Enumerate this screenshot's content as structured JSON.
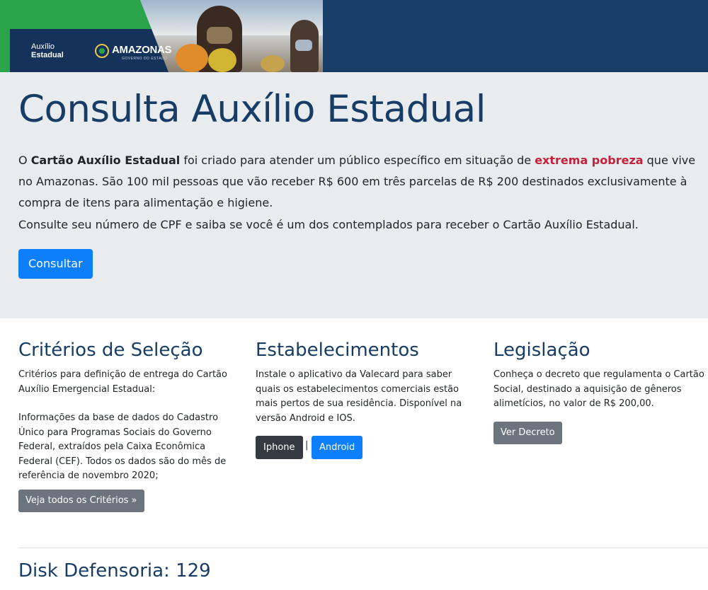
{
  "banner": {
    "brand_line1": "Auxílio",
    "brand_line2": "Estadual",
    "amazonas": "AMAZONAS",
    "amazonas_sub": "GOVERNO DO ESTADO"
  },
  "jumbotron": {
    "title": "Consulta Auxílio Estadual",
    "lead_p1_part1": "O ",
    "lead_p1_bold": "Cartão Auxílio Estadual",
    "lead_p1_part2": " foi criado para atender um público específico em situação de ",
    "lead_p1_highlight": "extrema pobreza",
    "lead_p1_part3": " que vive no Amazonas. São 100 mil pessoas que vão receber R$ 600 em três parcelas de R$ 200 destinados exclusivamente à compra de itens para alimentação e higiene.",
    "lead_p2": "Consulte seu número de CPF e saiba se você é um dos contemplados para receber o Cartão Auxílio Estadual.",
    "consult_button": "Consultar"
  },
  "columns": {
    "criterios": {
      "title": "Critérios de Seleção",
      "text1": "Critérios para definição de entrega do Cartão Auxílio Emergencial Estadual:",
      "text2": "Informações da base de dados do Cadastro Único para Programas Sociais do Governo Federal, extraídos pela Caixa Econômica Federal (CEF). Todos os dados são do mês de referência de novembro 2020;",
      "button": "Veja todos os Critérios »"
    },
    "estabelecimentos": {
      "title": "Estabelecimentos",
      "text": "Instale o aplicativo da Valecard para saber quais os estabelecimentos comerciais estão mais pertos de sua residência. Disponível na versão Android e IOS.",
      "iphone_button": "Iphone",
      "separator": "|",
      "android_button": "Android"
    },
    "legislacao": {
      "title": "Legislação",
      "text": "Conheça o decreto que regulamenta o Cartão Social, destinado a aquisição de gêneros alimetícios, no valor de R$ 200,00.",
      "button": "Ver Decreto"
    }
  },
  "footer": {
    "title": "Disk Defensoria: 129"
  },
  "colors": {
    "navy": "#173d67",
    "primary": "#0d7ffb",
    "secondary": "#6c757d",
    "dark": "#343a40",
    "danger": "#c6213a",
    "jumbotron_bg": "#e9ecef",
    "brand_green": "#2aa34a"
  }
}
